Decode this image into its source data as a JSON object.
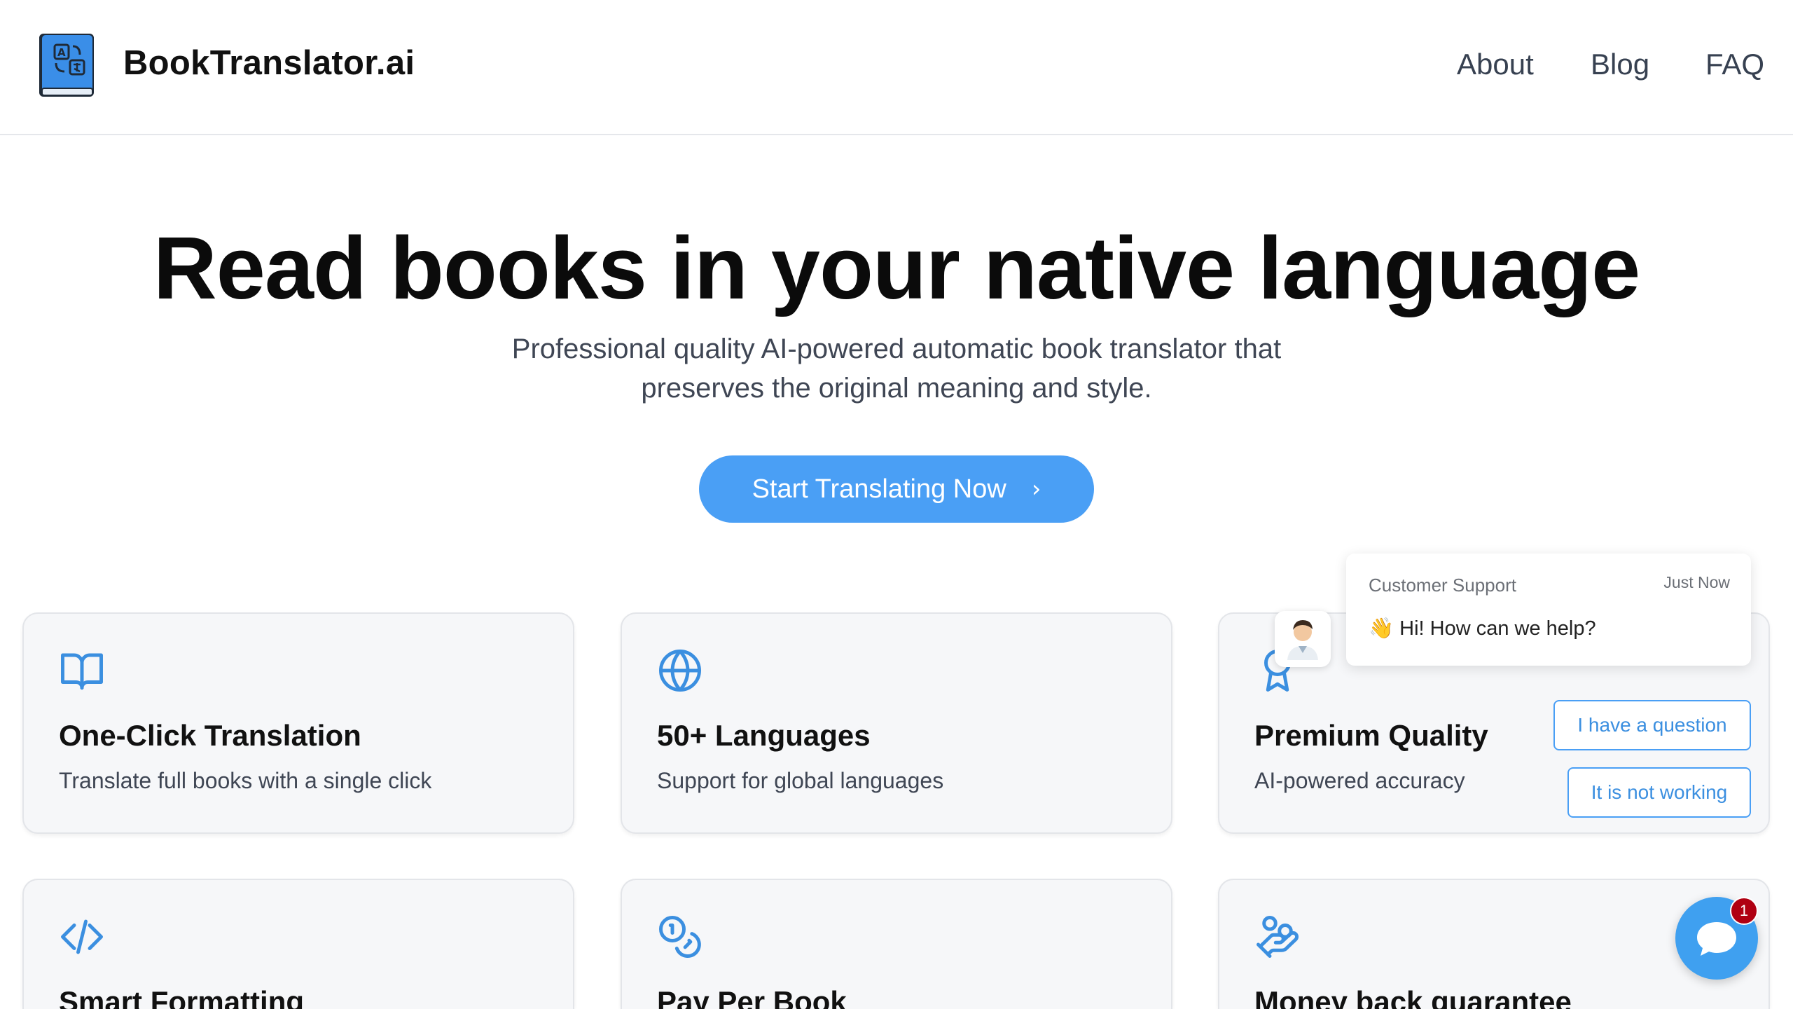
{
  "header": {
    "brand": "BookTranslator.ai",
    "nav": [
      "About",
      "Blog",
      "FAQ"
    ]
  },
  "hero": {
    "title": "Read books in your native language",
    "subtitle_line1": "Professional quality AI-powered automatic book translator that",
    "subtitle_line2": "preserves the original meaning and style.",
    "cta_label": "Start Translating Now"
  },
  "features": [
    {
      "icon": "book-open-icon",
      "title": "One-Click Translation",
      "description": "Translate full books with a single click"
    },
    {
      "icon": "globe-icon",
      "title": "50+ Languages",
      "description": "Support for global languages"
    },
    {
      "icon": "award-icon",
      "title": "Premium Quality",
      "description": "AI-powered accuracy"
    },
    {
      "icon": "code-icon",
      "title": "Smart Formatting",
      "description": ""
    },
    {
      "icon": "coins-icon",
      "title": "Pay Per Book",
      "description": ""
    },
    {
      "icon": "hand-coins-icon",
      "title": "Money back guarantee",
      "description": ""
    }
  ],
  "chat": {
    "from": "Customer Support",
    "time": "Just Now",
    "message": "👋 Hi! How can we help?",
    "quick_replies": [
      "I have a question",
      "It is not working"
    ],
    "unread_count": "1"
  },
  "colors": {
    "accent": "#4a9ff5",
    "icon_blue": "#3b8fe0",
    "card_bg": "#f6f7f9",
    "badge": "#b00012"
  }
}
